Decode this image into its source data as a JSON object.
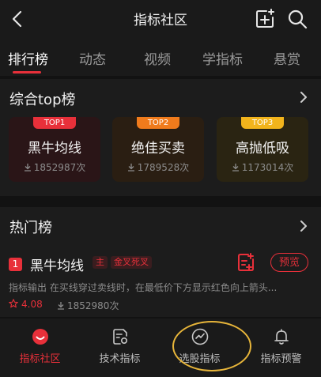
{
  "header": {
    "title": "指标社区"
  },
  "tabs": [
    {
      "label": "排行榜",
      "active": true
    },
    {
      "label": "动态"
    },
    {
      "label": "视频"
    },
    {
      "label": "学指标"
    },
    {
      "label": "悬赏"
    }
  ],
  "composite": {
    "title": "综合top榜",
    "items": [
      {
        "badge": "TOP1",
        "name": "黑牛均线",
        "count": "1852987次",
        "badge_color": "#e8303a"
      },
      {
        "badge": "TOP2",
        "name": "绝佳买卖",
        "count": "1789528次",
        "badge_color": "#f07b1c"
      },
      {
        "badge": "TOP3",
        "name": "高抛低吸",
        "count": "1173014次",
        "badge_color": "#f2b41c"
      }
    ]
  },
  "hot": {
    "title": "热门榜",
    "item": {
      "rank": "1",
      "name": "黑牛均线",
      "tags": [
        "主",
        "金叉死叉"
      ],
      "description": "指标输出 在买线穿过卖线时，在最低价下方显示红色向上箭头...",
      "rating": "4.08",
      "usage": "1852980次",
      "preview_label": "预览"
    }
  },
  "bottom_nav": [
    {
      "label": "指标社区",
      "icon": "community-icon",
      "active": true
    },
    {
      "label": "技术指标",
      "icon": "doc-settings-icon"
    },
    {
      "label": "选股指标",
      "icon": "trend-icon"
    },
    {
      "label": "指标预警",
      "icon": "bell-icon"
    }
  ],
  "colors": {
    "accent": "#e8303a",
    "background": "#121212",
    "highlight": "#e7b53a"
  }
}
